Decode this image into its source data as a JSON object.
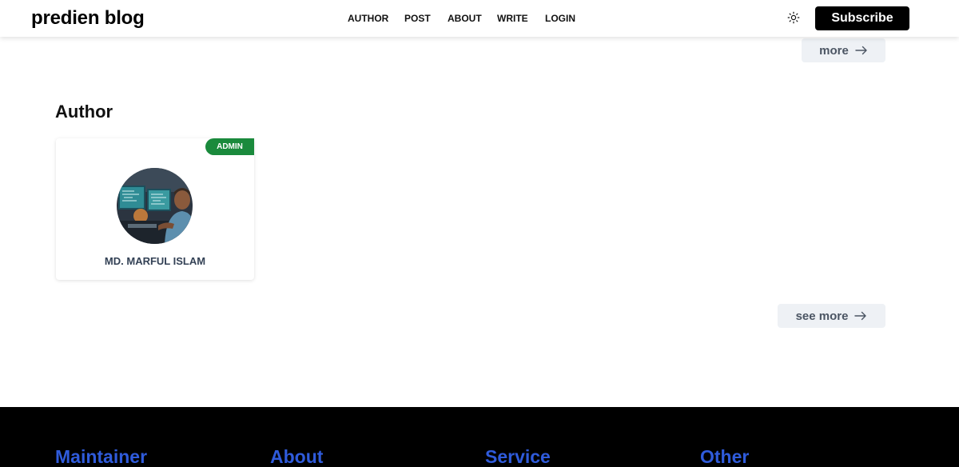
{
  "header": {
    "brand": "predien blog",
    "nav": [
      "AUTHOR",
      "POST",
      "ABOUT",
      "WRITE",
      "LOGIN"
    ],
    "theme_icon": "sun-icon",
    "subscribe_label": "Subscribe"
  },
  "top_more": {
    "label": "more",
    "icon": "arrow-right-icon"
  },
  "author_section": {
    "title": "Author",
    "card": {
      "badge": "ADMIN",
      "name": "MD. MARFUL ISLAM",
      "avatar": "avatar-photo"
    },
    "see_more": {
      "label": "see more",
      "icon": "arrow-right-icon"
    }
  },
  "footer": {
    "columns": [
      "Maintainer",
      "About",
      "Service",
      "Other"
    ]
  },
  "colors": {
    "badge": "#1a8a3c",
    "footer_bg": "#000000",
    "footer_heading": "#2f5bdb",
    "button_bg": "#eef1f5"
  }
}
